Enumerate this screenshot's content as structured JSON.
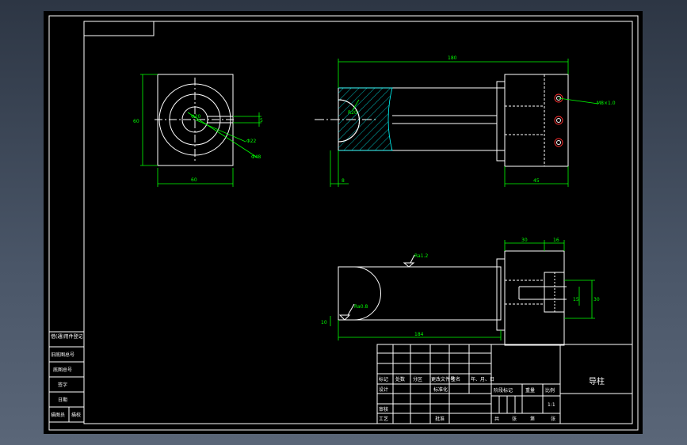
{
  "drawing": {
    "part_name": "导柱",
    "scale": "1:1",
    "dims": {
      "top_width": "60",
      "top_height": "60",
      "hole_dia": "Φ20",
      "ring_dia": "Φ22",
      "outer_dia": "Φ48",
      "slot_width": "5",
      "overall_length": "180",
      "end_length": "45",
      "left_offset": "8",
      "radius": "R20",
      "thread": "M8×1.0",
      "lower_length": "184",
      "lower_roughness_1": "Ra1.2",
      "lower_roughness_2": "Ra0.8",
      "left_small": "10",
      "seg_30": "30",
      "seg_16": "16",
      "height_30": "30",
      "height_15": "15"
    }
  },
  "title_block": {
    "rows": [
      [
        "标记",
        "处数",
        "分区",
        "更改文件号",
        "签名",
        "年、月、日"
      ],
      [
        "设计",
        "",
        "",
        "标准化",
        "",
        ""
      ],
      [
        "审核",
        "",
        "",
        "",
        "",
        ""
      ],
      [
        "工艺",
        "",
        "",
        "批准",
        "",
        ""
      ]
    ],
    "stage_label": "阶段标记",
    "weight_label": "重量",
    "scale_label": "比例",
    "total_sheets": "共",
    "sheet_unit": "张",
    "sheet_no": "第",
    "sheet_unit2": "张"
  },
  "side_strip": {
    "labels": [
      "借(通)用件登记",
      "旧底图总号",
      "底图总号",
      "签字",
      "日期",
      "描图员",
      "描校"
    ]
  }
}
